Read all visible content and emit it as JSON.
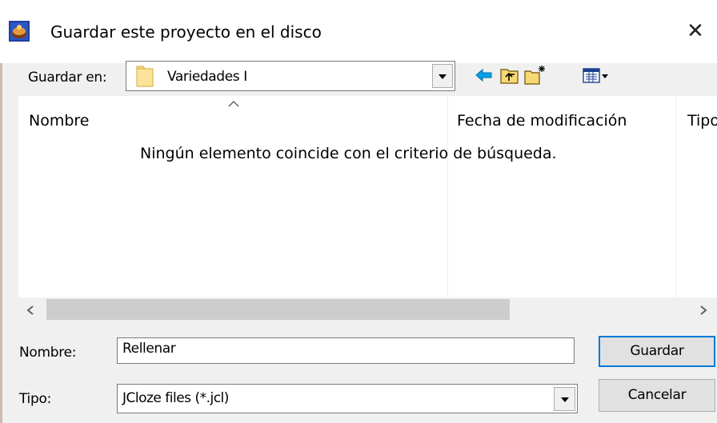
{
  "window": {
    "title": "Guardar este proyecto en el disco",
    "close_glyph": "✕",
    "app_icon": "jclic-app-icon"
  },
  "save_in": {
    "label": "Guardar en:",
    "value": "Variedades I",
    "icon": "folder-icon"
  },
  "toolbar": {
    "icons": [
      "back-arrow-icon",
      "up-folder-icon",
      "new-folder-icon",
      "view-menu-icon"
    ]
  },
  "list": {
    "columns": [
      "Nombre",
      "Fecha de modificación",
      "Tipo"
    ],
    "sort_indicator": "^",
    "empty_message": "Ningún elemento coincide con el criterio de búsqueda."
  },
  "scrollbar": {
    "left_glyph": "<",
    "right_glyph": ">"
  },
  "file_name": {
    "label": "Nombre:",
    "value": "Rellenar"
  },
  "file_type": {
    "label": "Tipo:",
    "value": "JCloze files (*.jcl)"
  },
  "buttons": {
    "save": "Guardar",
    "cancel": "Cancelar"
  },
  "colors": {
    "accent": "#0078d7",
    "folder": "#f8d775",
    "back_arrow": "#00a2e8"
  }
}
